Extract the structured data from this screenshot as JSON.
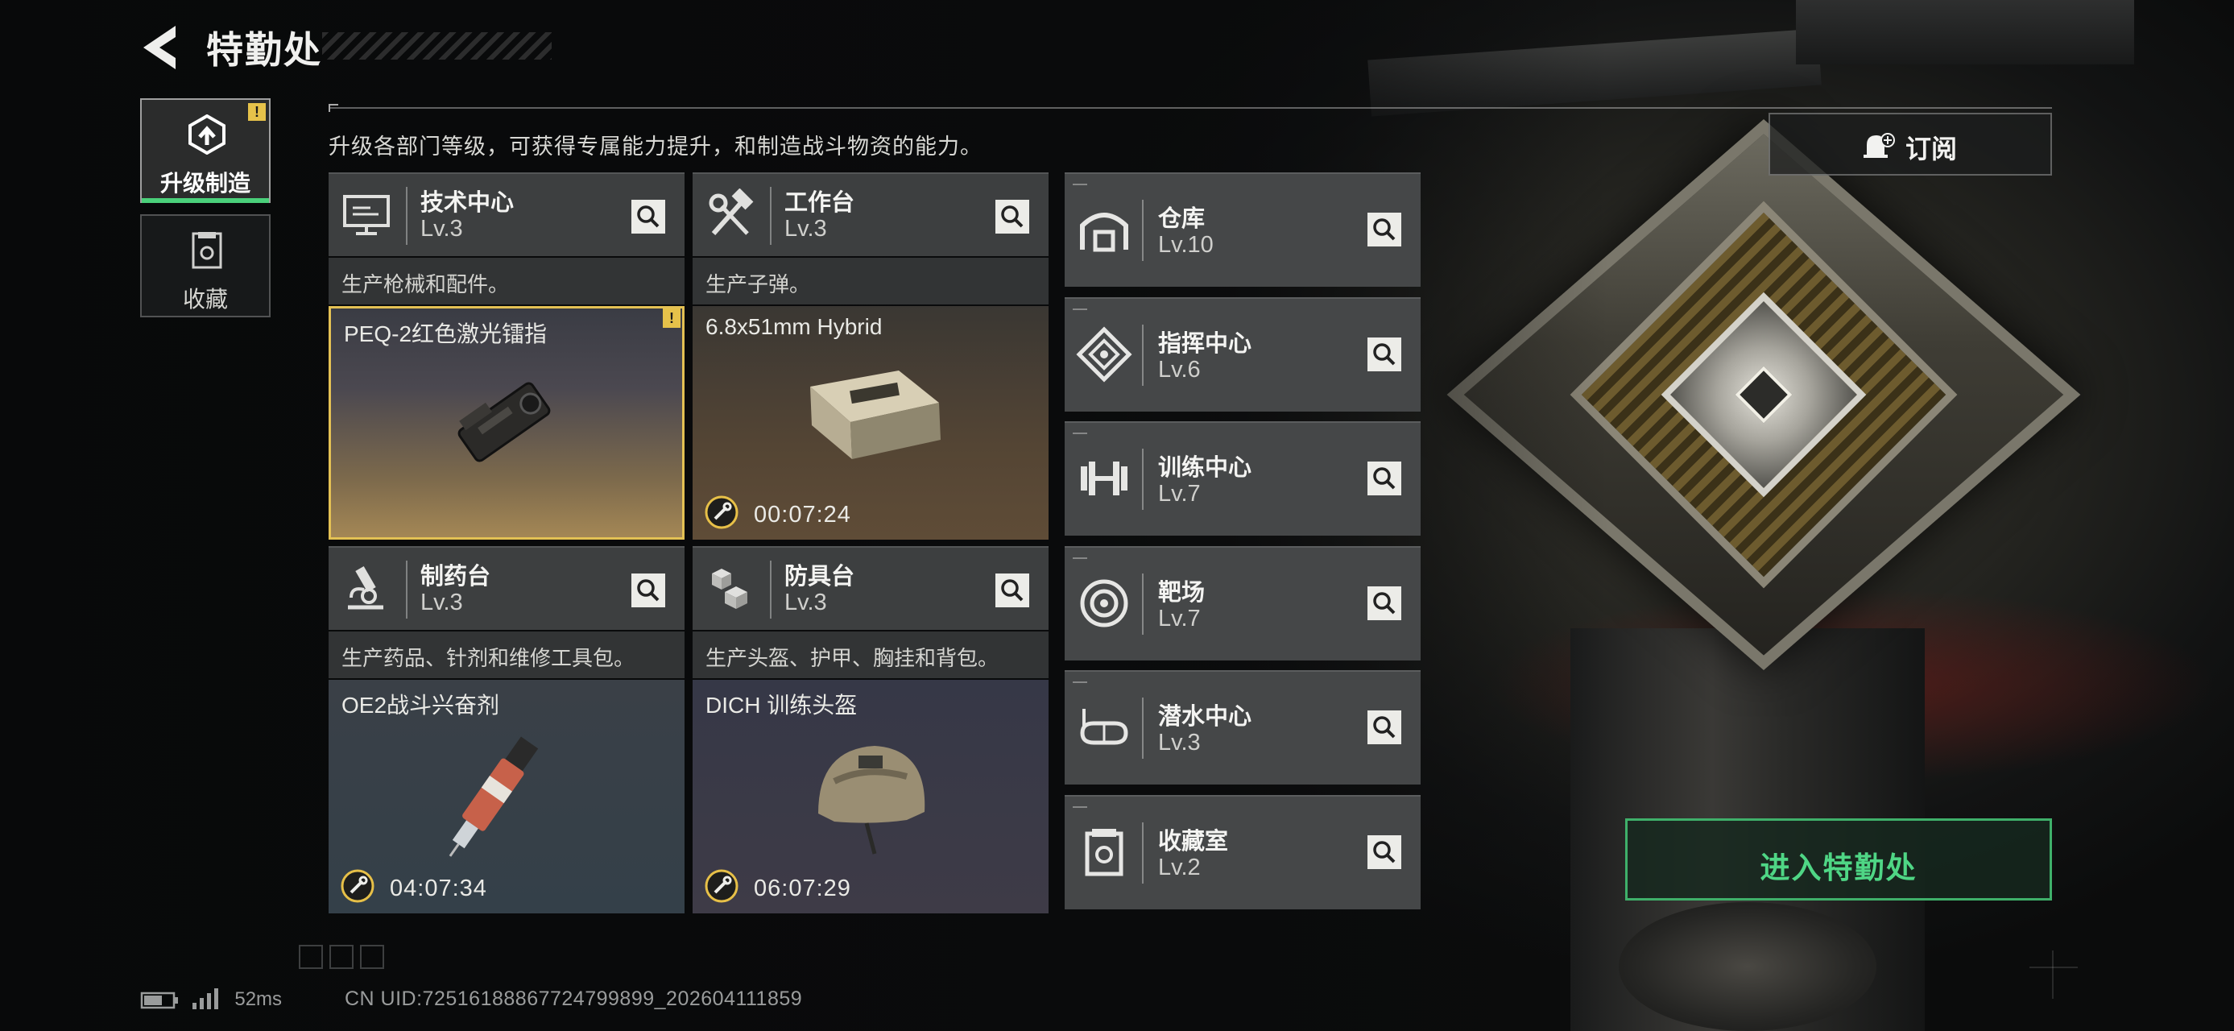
{
  "header": {
    "title": "特勤处"
  },
  "sidebar": {
    "tabs": [
      {
        "label": "升级制造",
        "active": true,
        "badge": "!"
      },
      {
        "label": "收藏",
        "active": false
      }
    ]
  },
  "intro": "升级各部门等级，可获得专属能力提升，和制造战斗物资的能力。",
  "subscribe_label": "订阅",
  "enter_label": "进入特勤处",
  "departments": [
    {
      "name": "技术中心",
      "level": "Lv.3",
      "desc": "生产枪械和配件。",
      "product": "PEQ-2红色激光镭指",
      "timer": "",
      "icon": "monitor-icon",
      "badge": "!"
    },
    {
      "name": "工作台",
      "level": "Lv.3",
      "desc": "生产子弹。",
      "product": "6.8x51mm Hybrid",
      "timer": "00:07:24",
      "icon": "hammer-wrench-icon"
    },
    {
      "name": "制药台",
      "level": "Lv.3",
      "desc": "生产药品、针剂和维修工具包。",
      "product": "OE2战斗兴奋剂",
      "timer": "04:07:34",
      "icon": "microscope-icon"
    },
    {
      "name": "防具台",
      "level": "Lv.3",
      "desc": "生产头盔、护甲、胸挂和背包。",
      "product": "DICH 训练头盔",
      "timer": "06:07:29",
      "icon": "boxes-icon"
    }
  ],
  "facilities": [
    {
      "name": "仓库",
      "level": "Lv.10",
      "icon": "warehouse-icon"
    },
    {
      "name": "指挥中心",
      "level": "Lv.6",
      "icon": "command-emblem-icon"
    },
    {
      "name": "训练中心",
      "level": "Lv.7",
      "icon": "dumbbell-icon"
    },
    {
      "name": "靶场",
      "level": "Lv.7",
      "icon": "target-icon"
    },
    {
      "name": "潜水中心",
      "level": "Lv.3",
      "icon": "dive-mask-icon"
    },
    {
      "name": "收藏室",
      "level": "Lv.2",
      "icon": "collection-icon"
    }
  ],
  "footer": {
    "ping": "52ms",
    "uid": "CN UID:7251618886772479989​9_202604111859"
  },
  "colors": {
    "accent_green": "#4fd685",
    "highlight_yellow": "#e4c154"
  }
}
